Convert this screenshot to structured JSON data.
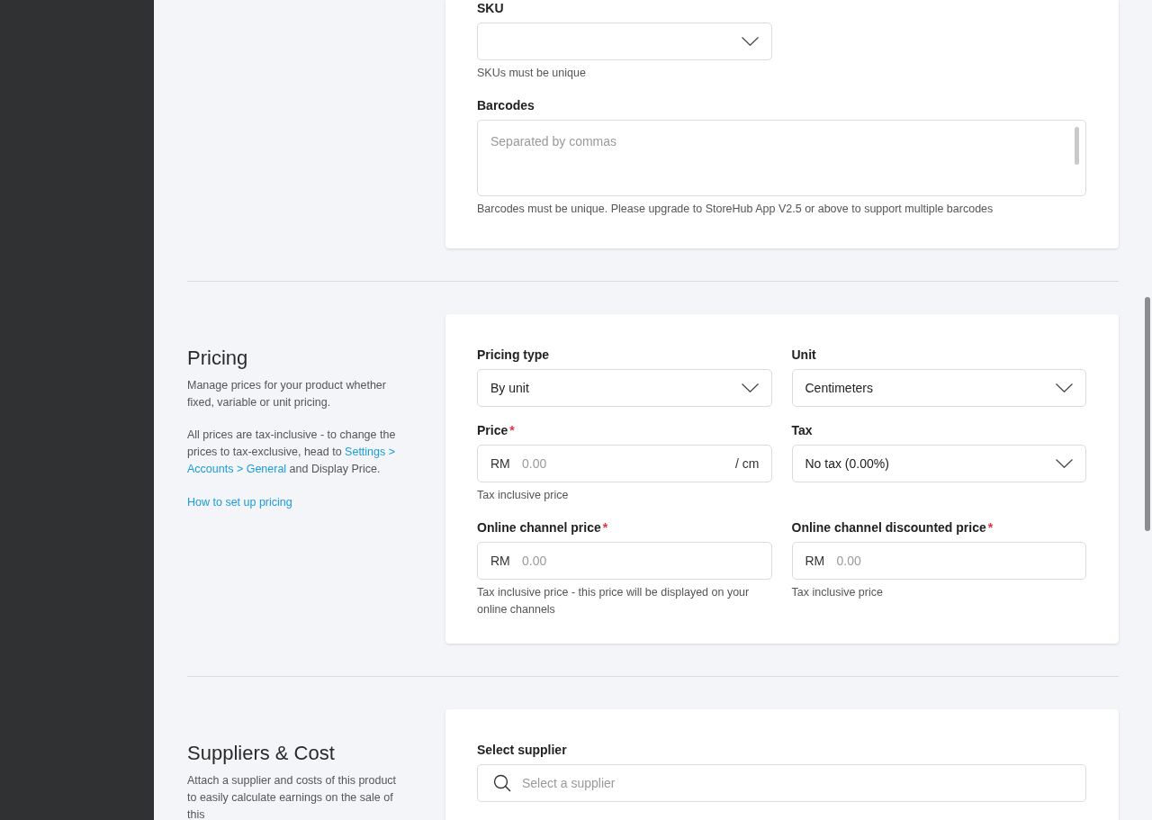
{
  "sections": [
    {
      "fields": [
        {
          "kind": "select",
          "label": "SKU",
          "helper": "SKUs must be unique"
        },
        {
          "kind": "textarea",
          "label": "Barcodes",
          "placeholder": "Separated by commas",
          "helper": "Barcodes must be unique. Please upgrade to StoreHub App V2.5 or above to support multiple barcodes"
        }
      ]
    },
    {
      "title": "Pricing",
      "description": [
        {
          "kind": "paragraph",
          "parts": [
            {
              "kind": "text",
              "text": "Manage prices for your product whether fixed, variable or unit pricing."
            }
          ]
        },
        {
          "kind": "paragraph",
          "parts": [
            {
              "kind": "text",
              "text": "All prices are tax-inclusive - to change the prices to tax-exclusive, head to "
            },
            {
              "kind": "link",
              "text": "Settings >"
            },
            {
              "kind": "link",
              "text": "Accounts > General"
            },
            {
              "kind": "text",
              "text": " and Display Price."
            }
          ]
        },
        {
          "kind": "link",
          "text": "How to set up pricing"
        }
      ],
      "fields": [
        {
          "kind": "select",
          "label": "Pricing type",
          "value": "By unit"
        },
        {
          "kind": "select",
          "label": "Unit",
          "value": "Centimeters"
        },
        {
          "kind": "money",
          "label": "Price",
          "asterisk": "*",
          "prefix": "RM",
          "placeholder": "0.00",
          "suffix": "/ cm",
          "helper": "Tax inclusive price"
        },
        {
          "kind": "select",
          "label": "Tax",
          "value": "No tax (0.00%)"
        },
        {
          "kind": "money",
          "label": "Online channel price",
          "asterisk": "*",
          "prefix": "RM",
          "placeholder": "0.00",
          "helper": "Tax inclusive price - this price will be displayed on your online channels"
        },
        {
          "kind": "money",
          "label": "Online channel discounted price",
          "asterisk": "*",
          "prefix": "RM",
          "placeholder": "0.00",
          "helper": "Tax inclusive price"
        }
      ]
    },
    {
      "title": "Suppliers & Cost",
      "description": [
        {
          "kind": "paragraph",
          "parts": [
            {
              "kind": "text",
              "text": "Attach a supplier and costs of this product to easily calculate earnings on the sale of this"
            }
          ]
        }
      ],
      "fields": [
        {
          "kind": "search",
          "label": "Select supplier",
          "placeholder": "Select a supplier"
        }
      ]
    }
  ]
}
